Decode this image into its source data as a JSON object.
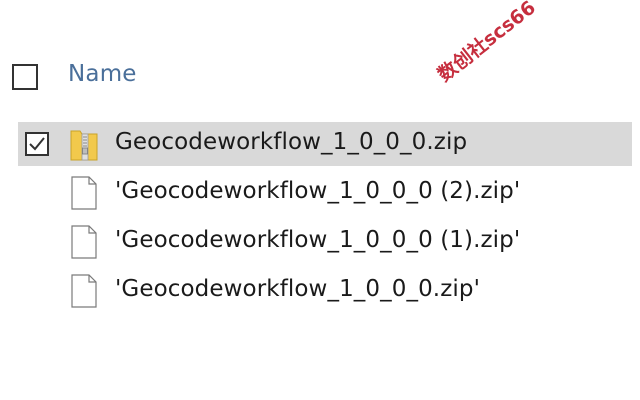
{
  "header": {
    "column_name_label": "Name"
  },
  "files": [
    {
      "name": "Geocodeworkflow_1_0_0_0.zip",
      "icon": "zip-folder-icon",
      "selected": true,
      "checked": true
    },
    {
      "name": "'Geocodeworkflow_1_0_0_0 (2).zip'",
      "icon": "blank-file-icon",
      "selected": false,
      "checked": false
    },
    {
      "name": "'Geocodeworkflow_1_0_0_0 (1).zip'",
      "icon": "blank-file-icon",
      "selected": false,
      "checked": false
    },
    {
      "name": "'Geocodeworkflow_1_0_0_0.zip'",
      "icon": "blank-file-icon",
      "selected": false,
      "checked": false
    }
  ],
  "watermark": "数创社scs66",
  "colors": {
    "header_text": "#4a6f9a",
    "selected_row_bg": "#d9d9d9",
    "watermark": "#c0182a",
    "zip_folder": "#f2c94c"
  }
}
